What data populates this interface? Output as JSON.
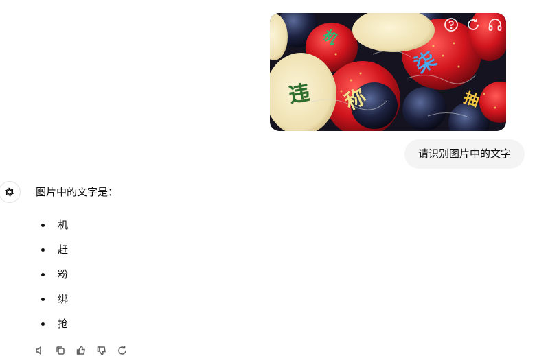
{
  "conversation": {
    "user_message": "请识别图片中的文字",
    "assistant_intro": "图片中的文字是：",
    "answer_items": [
      {
        "label": "机"
      },
      {
        "label": "赶"
      },
      {
        "label": "粉"
      },
      {
        "label": "绑"
      },
      {
        "label": "抢"
      }
    ]
  },
  "captcha_image": {
    "overlay_characters": [
      {
        "char": "机",
        "color": "#2bbf7a"
      },
      {
        "char": "柒",
        "color": "#4ea8e8"
      },
      {
        "char": "违",
        "color": "#2c6e2c"
      },
      {
        "char": "称",
        "color": "#f1e28c"
      },
      {
        "char": "抽",
        "color": "#f3c842"
      }
    ],
    "toolbar_icons": [
      "help-icon",
      "refresh-icon",
      "headphones-icon"
    ]
  },
  "actions": {
    "icons": [
      "copy-icon",
      "thumbs-up-icon",
      "thumbs-down-icon",
      "read-aloud-icon",
      "regenerate-icon"
    ]
  }
}
